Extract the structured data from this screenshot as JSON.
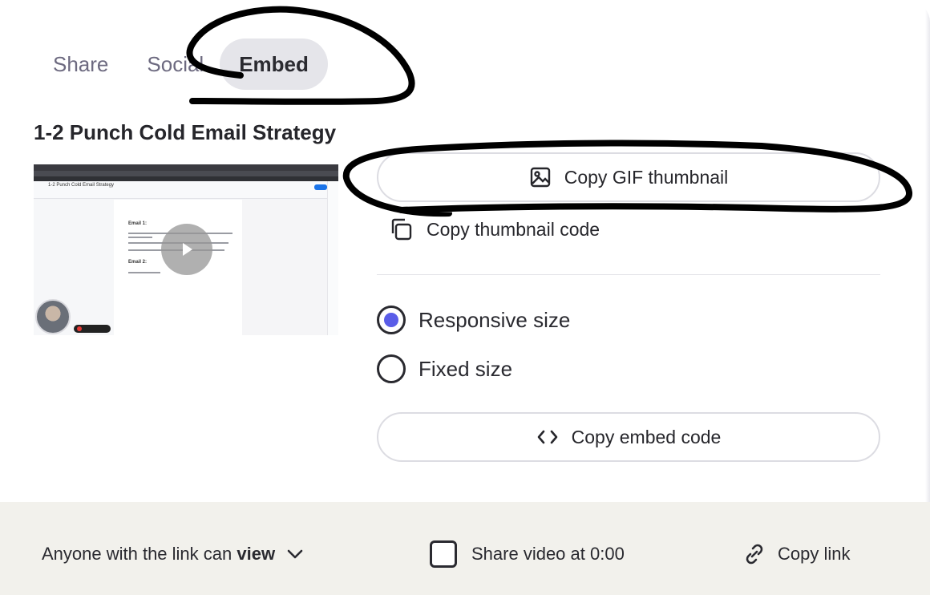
{
  "tabs": [
    {
      "label": "Share"
    },
    {
      "label": "Social"
    },
    {
      "label": "Embed",
      "active": true
    }
  ],
  "video": {
    "title": "1-2 Punch Cold Email Strategy",
    "thumbnail_doc_title": "1-2 Punch Cold Email Strategy",
    "thumbnail_headings": [
      "Email 1:",
      "Email 2:"
    ]
  },
  "actions": {
    "copy_gif_thumbnail": "Copy GIF thumbnail",
    "copy_thumbnail_code": "Copy thumbnail code",
    "copy_embed_code": "Copy embed code"
  },
  "size_options": {
    "responsive": {
      "label": "Responsive size",
      "selected": true
    },
    "fixed": {
      "label": "Fixed size",
      "selected": false
    }
  },
  "footer": {
    "permission_prefix": "Anyone with the link can",
    "permission_value": "view",
    "share_at_label": "Share video at 0:00",
    "share_at_checked": false,
    "copy_link": "Copy link"
  },
  "colors": {
    "radio_selected": "#5a5de8",
    "footer_bg": "#f2f1ec",
    "active_tab_bg": "#e5e5ea"
  },
  "icons": {
    "gif_button": "image-icon",
    "thumbnail_code": "copy-icon",
    "embed_button": "code-brackets-icon",
    "permission": "chevron-down-icon",
    "copy_link": "link-icon"
  }
}
